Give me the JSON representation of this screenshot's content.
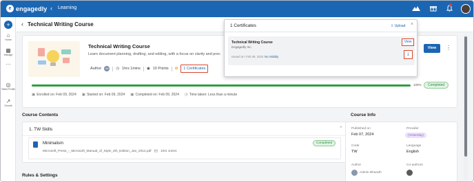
{
  "topbar": {
    "logo_text": "engagedly",
    "breadcrumb": "Learning",
    "icons": [
      "mountains-icon",
      "gift-icon",
      "bell-icon",
      "avatar"
    ]
  },
  "rail": {
    "items": [
      {
        "label": "Home",
        "icon": "home-icon"
      },
      {
        "label": "Manage",
        "icon": "manage-icon"
      },
      {
        "label": "···",
        "icon": "more-icon"
      },
      {
        "label": "Talent Profile",
        "icon": "profile-icon"
      },
      {
        "label": "Growth",
        "icon": "growth-icon"
      }
    ]
  },
  "page": {
    "title": "Technical Writing Course"
  },
  "course": {
    "name": "Technical Writing Course",
    "description": "Learn document planning, drafting, and editing, with a focus on clarity and prec",
    "author_label": "Author",
    "author_initials": "AB",
    "duration": "1hrs 1mins",
    "points": "10 Points",
    "certificates_link": "1 Certificates",
    "view_label": "View",
    "progress": 100,
    "progress_label": "100%",
    "status": "Completed",
    "enrolled": "Enrolled on: Feb 09, 2024",
    "started": "Started on: Feb 09, 2024",
    "completed": "Completed on: Feb 09, 2024",
    "time_taken": "Time taken: Less than a minute"
  },
  "contents": {
    "heading": "Course Contents",
    "module_title": "1. TW Skills",
    "item_title": "Minimalism",
    "item_file": "Microsoft_Press_-_Microsoft_Manual_of_Style_4th_Edition_Jan_2012.pdf",
    "item_duration": "1hrs 1mins",
    "item_status": "Completed",
    "rules_heading": "Rules & Settings"
  },
  "info": {
    "heading": "Course Info",
    "published_label": "Published on",
    "published_value": "Feb 07, 2024",
    "provider_label": "Provider",
    "provider_value": "(Yesterday)",
    "code_label": "Code",
    "code_value": "TW",
    "language_label": "Language",
    "language_value": "English",
    "author_label": "Author",
    "author_value": "Admin Bharath",
    "coauthors_label": "Co-authors"
  },
  "popup": {
    "title": "1 Certificates",
    "upload_label": "Upload",
    "cert_name": "Technical Writing Course",
    "cert_org": "Engagedly Inc.",
    "issued": "Issued on: Feb 09, 2024",
    "validity": "No Validity",
    "view_label": "View"
  }
}
